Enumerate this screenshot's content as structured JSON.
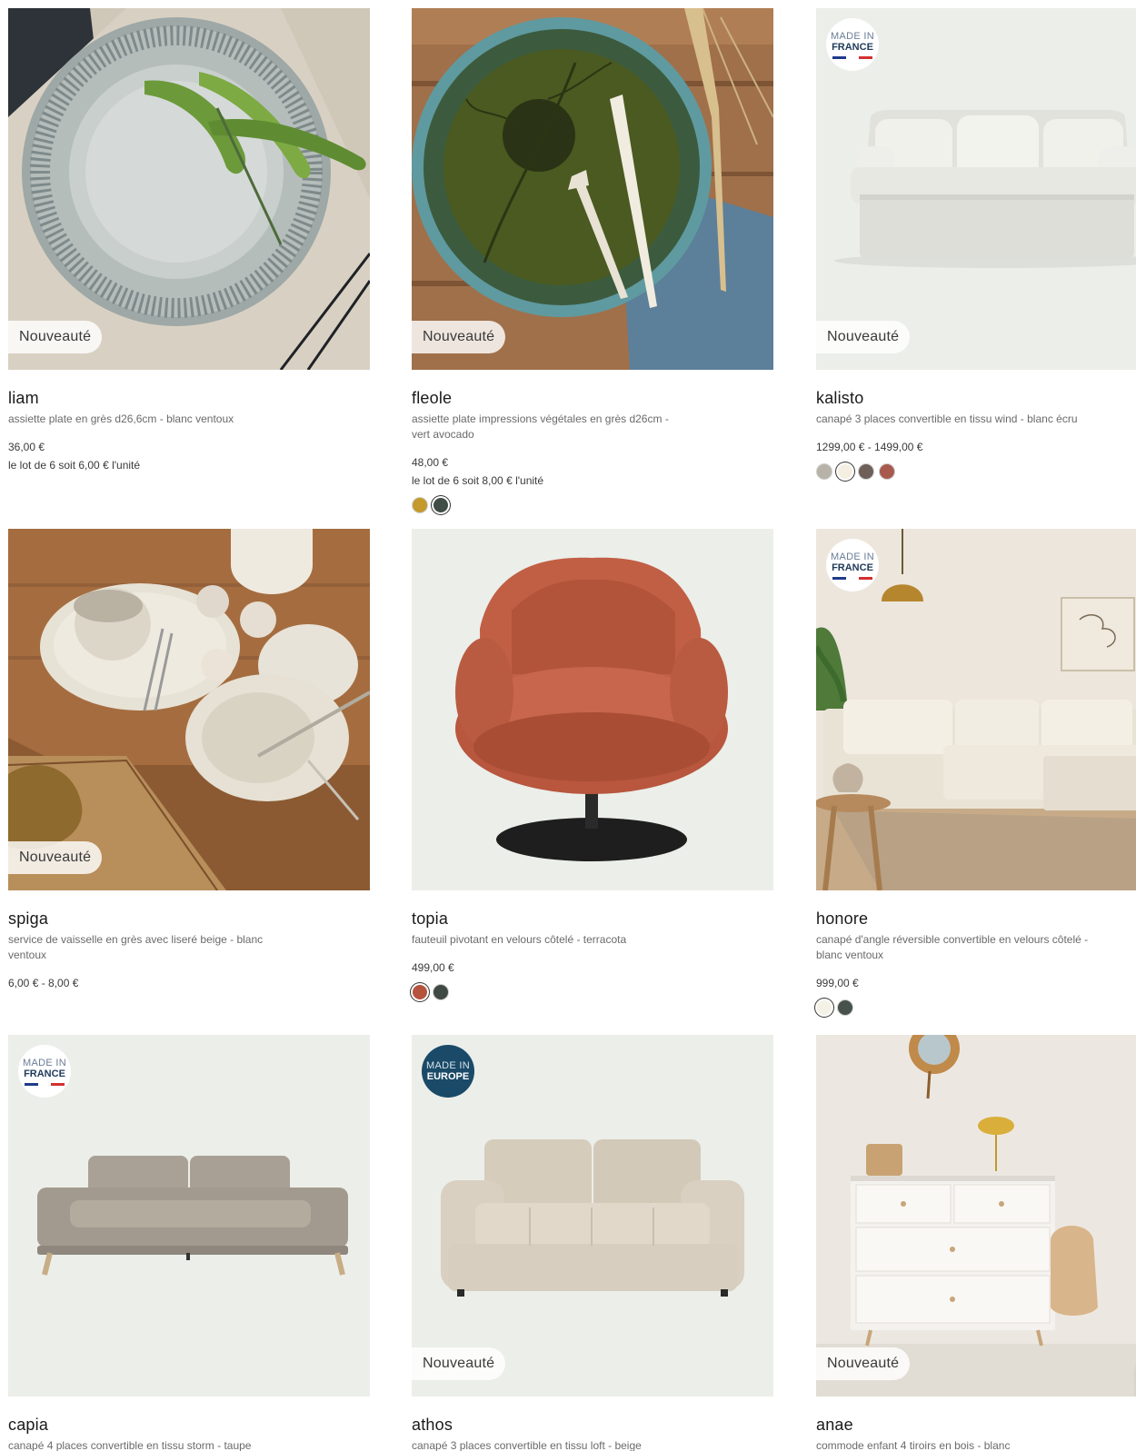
{
  "labels": {
    "new_badge": "Nouveauté",
    "made_in": "MADE IN",
    "france": "FRANCE",
    "europe": "EUROPE"
  },
  "products": [
    {
      "name": "liam",
      "desc": "assiette plate en grès d26,6cm - blanc ventoux",
      "price": "36,00 €",
      "unit": "le lot de 6 soit 6,00 € l'unité",
      "swatches": []
    },
    {
      "name": "fleole",
      "desc": "assiette plate impressions végétales en grès d26cm - vert avocado",
      "price": "48,00 €",
      "unit": "le lot de 6 soit 8,00 € l'unité",
      "swatches": [
        "#c39a2b",
        "#3f4d45"
      ]
    },
    {
      "name": "kalisto",
      "desc": "canapé 3 places convertible en tissu wind - blanc écru",
      "price": "1299,00 € - 1499,00 €",
      "swatches": [
        "#b8b3a8",
        "#f4efe1",
        "#6e5f58",
        "#a85a4f"
      ]
    },
    {
      "name": "spiga",
      "desc": "service de vaisselle en grès avec liseré beige - blanc ventoux",
      "price": "6,00 € - 8,00 €",
      "swatches": []
    },
    {
      "name": "topia",
      "desc": "fauteuil pivotant en velours côtelé - terracota",
      "price": "499,00 €",
      "swatches": [
        "#b5533f",
        "#3f4a45"
      ]
    },
    {
      "name": "honore",
      "desc": "canapé d'angle réversible convertible en velours côtelé - blanc ventoux",
      "price": "999,00 €",
      "swatches": [
        "#f4f1e6",
        "#48524d"
      ]
    },
    {
      "name": "capia",
      "desc": "canapé 4 places convertible en tissu storm - taupe"
    },
    {
      "name": "athos",
      "desc": "canapé 3 places convertible en tissu loft - beige"
    },
    {
      "name": "anae",
      "desc": "commode enfant 4 tiroirs en bois - blanc"
    }
  ]
}
